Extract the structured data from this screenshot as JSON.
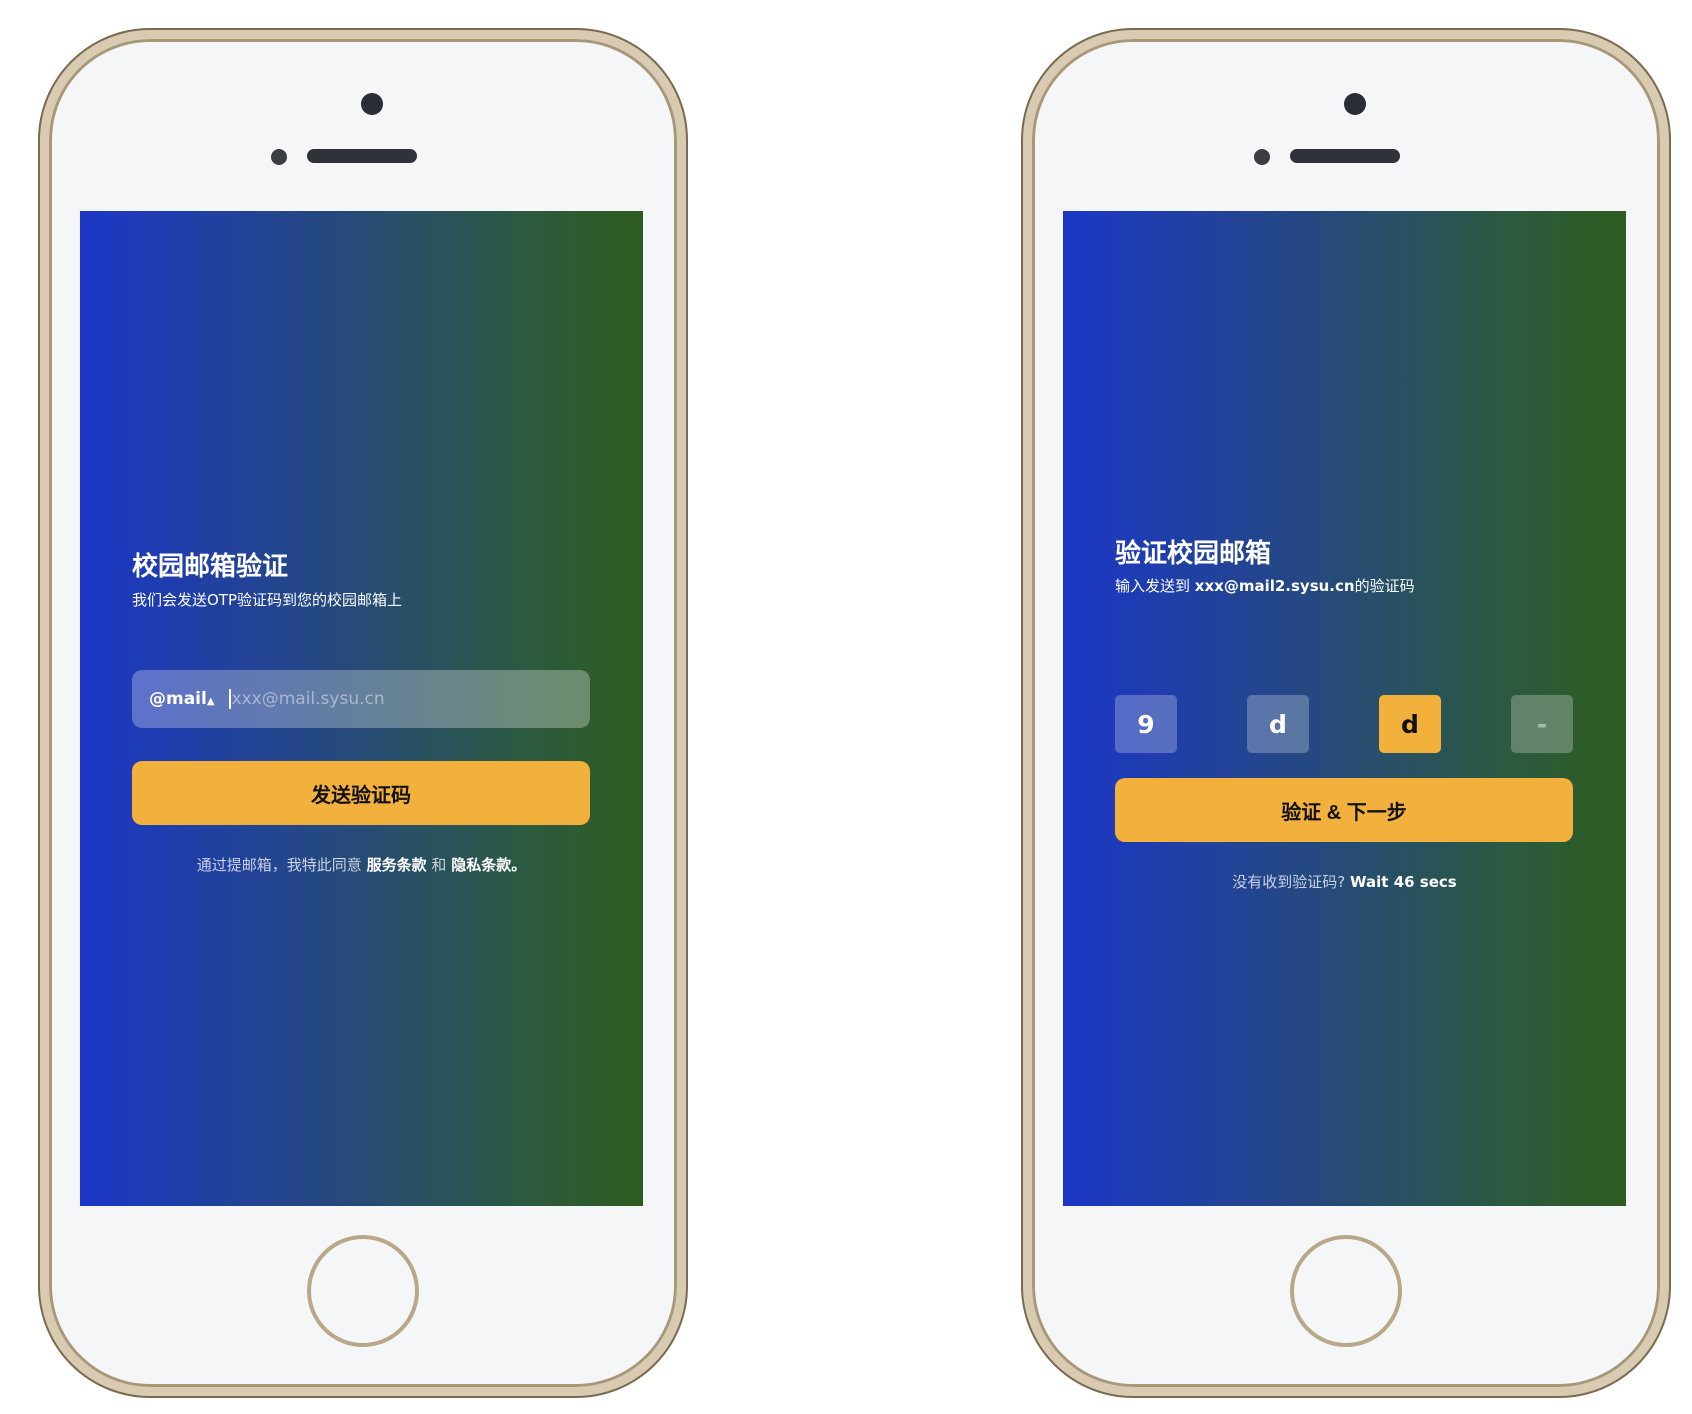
{
  "left_screen": {
    "title": "校园邮箱验证",
    "subtitle": "我们会发送OTP验证码到您的校园邮箱上",
    "domain_select": "@mail",
    "domain_select_icon": "updown-chevron-icon",
    "email_placeholder": "xxx@mail.sysu.cn",
    "send_button": "发送验证码",
    "terms_prefix": "通过提邮箱，我特此同意",
    "terms_link": "服务条款",
    "terms_and": "和",
    "privacy_link": "隐私条款。"
  },
  "right_screen": {
    "title": "验证校园邮箱",
    "subtitle_prefix": "输入发送到",
    "email": "xxx@mail2.sysu.cn",
    "subtitle_suffix": "的验证码",
    "otp": [
      "9",
      "d",
      "d",
      "-"
    ],
    "verify_button": "验证 & 下一步",
    "resend_prefix": "没有收到验证码?",
    "resend_timer": "Wait 46 secs"
  },
  "colors": {
    "accent": "#f2b03c",
    "gradient_start": "#1c37c7",
    "gradient_end": "#2e5c1f"
  }
}
